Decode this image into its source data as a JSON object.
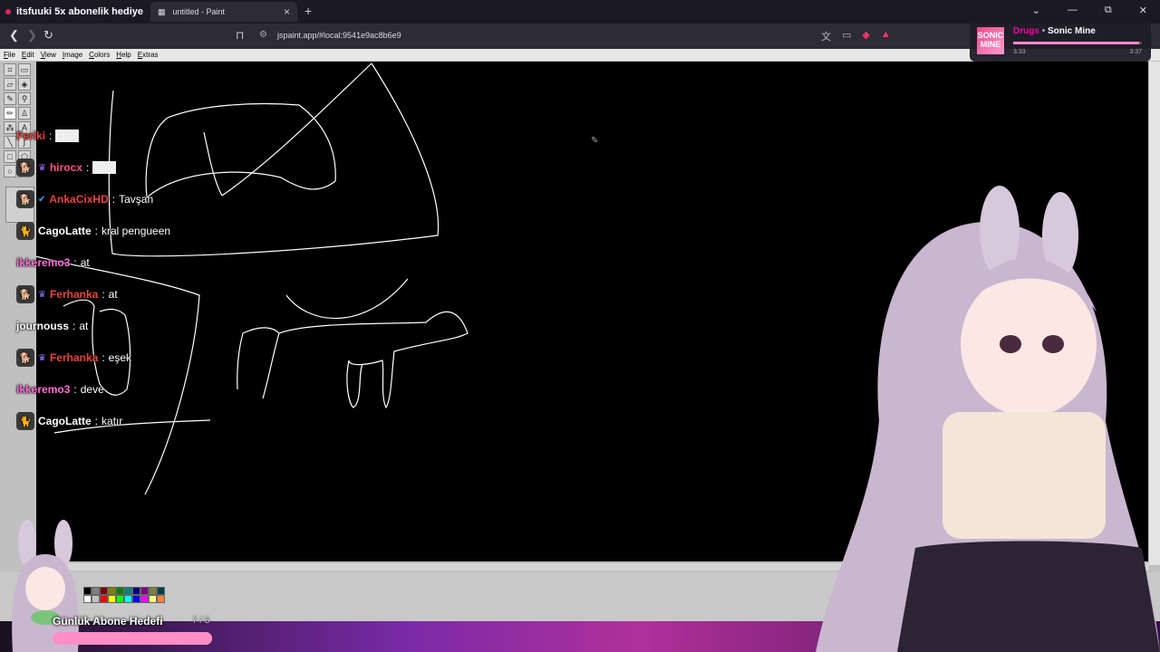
{
  "browser": {
    "inactive_tab": "itsfuuki 5x abonelik hediye",
    "active_tab": "untitled - Paint",
    "tab_close": "×",
    "new_tab": "+",
    "url": "jspaint.app/#local:9541e9ac8b6e9",
    "win_controls": [
      "⌄",
      "—",
      "⧉",
      "✕"
    ]
  },
  "paint": {
    "menu": [
      "File",
      "Edit",
      "View",
      "Image",
      "Colors",
      "Help",
      "Extras"
    ],
    "palette": [
      "#000000",
      "#808080",
      "#800000",
      "#808000",
      "#008000",
      "#008080",
      "#000080",
      "#800080",
      "#808040",
      "#004040",
      "#ffffff",
      "#c0c0c0",
      "#ff0000",
      "#ffff00",
      "#00ff00",
      "#00ffff",
      "#0000ff",
      "#ff00ff",
      "#ffff80",
      "#ff8040"
    ]
  },
  "chat": [
    {
      "user": "Feriki",
      "color": "#e8453c",
      "message": "",
      "emote": true,
      "icon": "none"
    },
    {
      "user": "hirocx",
      "color": "#ff4f8b",
      "message": "",
      "emote": true,
      "icon": "dog-icon",
      "badge": "sub"
    },
    {
      "user": "AnkaCixHD",
      "color": "#e8453c",
      "message": "Tavşan",
      "icon": "dog-icon",
      "badge": "verified"
    },
    {
      "user": "CagoLatte",
      "color": "#ffffff",
      "message": "kral pengueen",
      "icon": "cat-icon"
    },
    {
      "user": "ikkeremo3",
      "color": "#ff6fd8",
      "message": "at",
      "icon": "none"
    },
    {
      "user": "Ferhanka",
      "color": "#e8453c",
      "message": "at",
      "icon": "dog-icon",
      "badge": "sub"
    },
    {
      "user": "journouss",
      "color": "#ffffff",
      "message": "at",
      "icon": "none"
    },
    {
      "user": "Ferhanka",
      "color": "#e8453c",
      "message": "eşek",
      "icon": "dog-icon",
      "badge": "sub"
    },
    {
      "user": "ikkeremo3",
      "color": "#ff6fd8",
      "message": "deve",
      "icon": "none"
    },
    {
      "user": "CagoLatte",
      "color": "#ffffff",
      "message": "katır",
      "icon": "cat-icon"
    }
  ],
  "chat_sep": ":",
  "now_playing": {
    "art_text": "SONIC MINE",
    "track": "Drugs",
    "dot": "•",
    "artist": "Sonic Mine",
    "elapsed": "3:33",
    "total": "3:37",
    "progress": 0.98
  },
  "goal": {
    "label": "Günlük Abone Hedefi",
    "count": "7 / 5",
    "progress": 1.0
  }
}
